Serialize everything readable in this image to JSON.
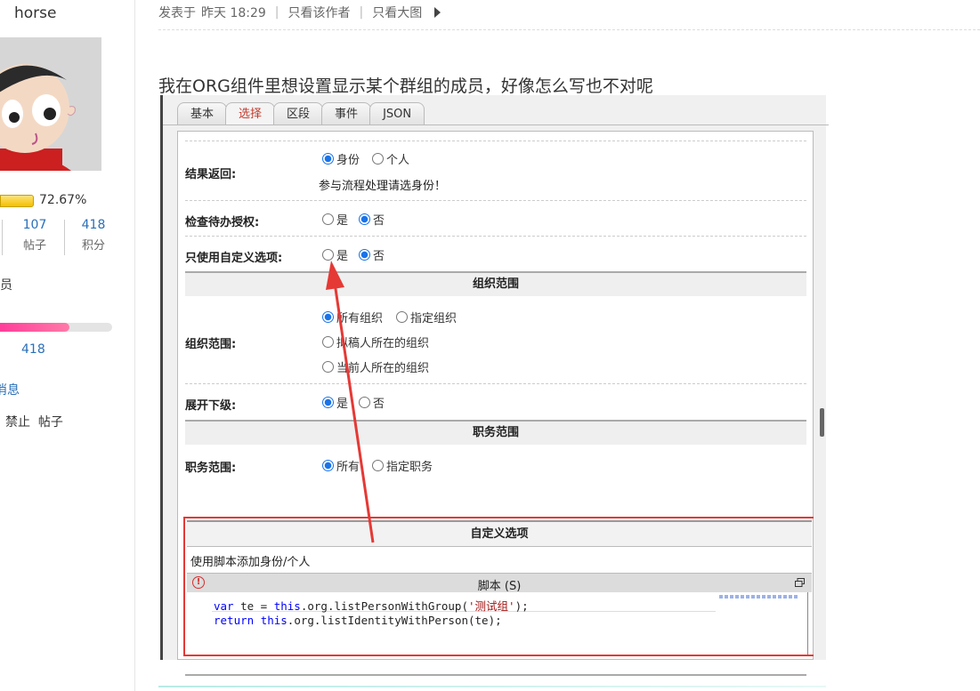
{
  "sidebar": {
    "username": "horse",
    "level_percent": "72.67%",
    "stats": [
      {
        "num": "107",
        "label": "帖子"
      },
      {
        "num": "418",
        "label": "积分"
      }
    ],
    "rank_fragment": "员",
    "progress_value": "418",
    "message_fragment": "消息",
    "forbid_text": "禁止  帖子"
  },
  "post": {
    "meta_prefix": "发表于",
    "meta_time": "昨天 18:29",
    "only_author": "只看该作者",
    "only_big_image": "只看大图",
    "content": "我在ORG组件里想设置显示某个群组的成员，好像怎么写也不对呢"
  },
  "editor_screenshot": {
    "tabs": [
      {
        "label": "基本",
        "active": false
      },
      {
        "label": "选择",
        "active": true
      },
      {
        "label": "区段",
        "active": false
      },
      {
        "label": "事件",
        "active": false
      },
      {
        "label": "JSON",
        "active": false
      }
    ],
    "result_return": {
      "label": "结果返回:",
      "opt_identity": "身份",
      "opt_person": "个人",
      "hint": "参与流程处理请选身份！"
    },
    "check_todo": {
      "label": "检查待办授权:",
      "yes": "是",
      "no": "否"
    },
    "only_custom": {
      "label": "只使用自定义选项:",
      "yes": "是",
      "no": "否"
    },
    "org_section_title": "组织范围",
    "org_scope": {
      "label": "组织范围:",
      "all": "所有组织",
      "specified": "指定组织",
      "drafter": "拟稿人所在的组织",
      "current": "当前人所在的组织"
    },
    "expand_sub": {
      "label": "展开下级:",
      "yes": "是",
      "no": "否"
    },
    "duty_section_title": "职务范围",
    "duty_scope": {
      "label": "职务范围:",
      "all": "所有",
      "specified": "指定职务"
    },
    "custom_section_title": "自定义选项",
    "custom_desc": "使用脚本添加身份/个人",
    "script_title": "脚本 (S)",
    "code": {
      "line1_kw1": "var",
      "line1_mid": " te = ",
      "line1_kw2": "this",
      "line1_call": ".org.listPersonWithGroup(",
      "line1_str": "'测试组'",
      "line1_end": ");",
      "line2_kw1": "return",
      "line2_sp": " ",
      "line2_kw2": "this",
      "line2_rest": ".org.listIdentityWithPerson(te);"
    },
    "highlight_color": "#e53935"
  }
}
